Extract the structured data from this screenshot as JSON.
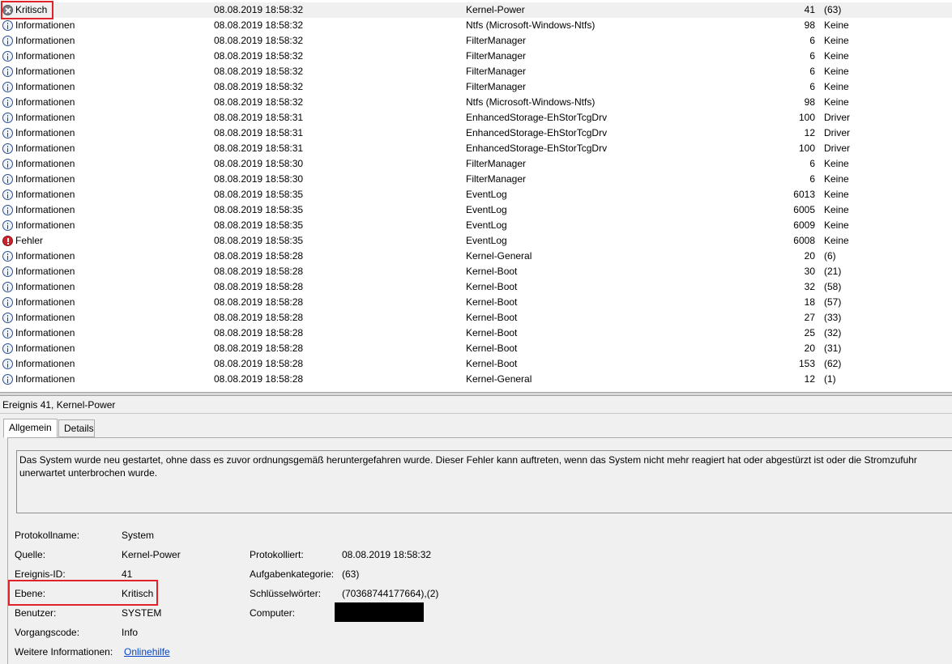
{
  "events": [
    {
      "level": "Kritisch",
      "icon": "critical-icon",
      "date": "08.08.2019 18:58:32",
      "source": "Kernel-Power",
      "id": "41",
      "task": "(63)"
    },
    {
      "level": "Informationen",
      "icon": "info-icon",
      "date": "08.08.2019 18:58:32",
      "source": "Ntfs (Microsoft-Windows-Ntfs)",
      "id": "98",
      "task": "Keine"
    },
    {
      "level": "Informationen",
      "icon": "info-icon",
      "date": "08.08.2019 18:58:32",
      "source": "FilterManager",
      "id": "6",
      "task": "Keine"
    },
    {
      "level": "Informationen",
      "icon": "info-icon",
      "date": "08.08.2019 18:58:32",
      "source": "FilterManager",
      "id": "6",
      "task": "Keine"
    },
    {
      "level": "Informationen",
      "icon": "info-icon",
      "date": "08.08.2019 18:58:32",
      "source": "FilterManager",
      "id": "6",
      "task": "Keine"
    },
    {
      "level": "Informationen",
      "icon": "info-icon",
      "date": "08.08.2019 18:58:32",
      "source": "FilterManager",
      "id": "6",
      "task": "Keine"
    },
    {
      "level": "Informationen",
      "icon": "info-icon",
      "date": "08.08.2019 18:58:32",
      "source": "Ntfs (Microsoft-Windows-Ntfs)",
      "id": "98",
      "task": "Keine"
    },
    {
      "level": "Informationen",
      "icon": "info-icon",
      "date": "08.08.2019 18:58:31",
      "source": "EnhancedStorage-EhStorTcgDrv",
      "id": "100",
      "task": "Driver"
    },
    {
      "level": "Informationen",
      "icon": "info-icon",
      "date": "08.08.2019 18:58:31",
      "source": "EnhancedStorage-EhStorTcgDrv",
      "id": "12",
      "task": "Driver"
    },
    {
      "level": "Informationen",
      "icon": "info-icon",
      "date": "08.08.2019 18:58:31",
      "source": "EnhancedStorage-EhStorTcgDrv",
      "id": "100",
      "task": "Driver"
    },
    {
      "level": "Informationen",
      "icon": "info-icon",
      "date": "08.08.2019 18:58:30",
      "source": "FilterManager",
      "id": "6",
      "task": "Keine"
    },
    {
      "level": "Informationen",
      "icon": "info-icon",
      "date": "08.08.2019 18:58:30",
      "source": "FilterManager",
      "id": "6",
      "task": "Keine"
    },
    {
      "level": "Informationen",
      "icon": "info-icon",
      "date": "08.08.2019 18:58:35",
      "source": "EventLog",
      "id": "6013",
      "task": "Keine"
    },
    {
      "level": "Informationen",
      "icon": "info-icon",
      "date": "08.08.2019 18:58:35",
      "source": "EventLog",
      "id": "6005",
      "task": "Keine"
    },
    {
      "level": "Informationen",
      "icon": "info-icon",
      "date": "08.08.2019 18:58:35",
      "source": "EventLog",
      "id": "6009",
      "task": "Keine"
    },
    {
      "level": "Fehler",
      "icon": "error-icon",
      "date": "08.08.2019 18:58:35",
      "source": "EventLog",
      "id": "6008",
      "task": "Keine"
    },
    {
      "level": "Informationen",
      "icon": "info-icon",
      "date": "08.08.2019 18:58:28",
      "source": "Kernel-General",
      "id": "20",
      "task": "(6)"
    },
    {
      "level": "Informationen",
      "icon": "info-icon",
      "date": "08.08.2019 18:58:28",
      "source": "Kernel-Boot",
      "id": "30",
      "task": "(21)"
    },
    {
      "level": "Informationen",
      "icon": "info-icon",
      "date": "08.08.2019 18:58:28",
      "source": "Kernel-Boot",
      "id": "32",
      "task": "(58)"
    },
    {
      "level": "Informationen",
      "icon": "info-icon",
      "date": "08.08.2019 18:58:28",
      "source": "Kernel-Boot",
      "id": "18",
      "task": "(57)"
    },
    {
      "level": "Informationen",
      "icon": "info-icon",
      "date": "08.08.2019 18:58:28",
      "source": "Kernel-Boot",
      "id": "27",
      "task": "(33)"
    },
    {
      "level": "Informationen",
      "icon": "info-icon",
      "date": "08.08.2019 18:58:28",
      "source": "Kernel-Boot",
      "id": "25",
      "task": "(32)"
    },
    {
      "level": "Informationen",
      "icon": "info-icon",
      "date": "08.08.2019 18:58:28",
      "source": "Kernel-Boot",
      "id": "20",
      "task": "(31)"
    },
    {
      "level": "Informationen",
      "icon": "info-icon",
      "date": "08.08.2019 18:58:28",
      "source": "Kernel-Boot",
      "id": "153",
      "task": "(62)"
    },
    {
      "level": "Informationen",
      "icon": "info-icon",
      "date": "08.08.2019 18:58:28",
      "source": "Kernel-General",
      "id": "12",
      "task": "(1)"
    }
  ],
  "detail": {
    "header": "Ereignis 41, Kernel-Power",
    "tabs": [
      "Allgemein",
      "Details"
    ],
    "description": "Das System wurde neu gestartet, ohne dass es zuvor ordnungsgemäß heruntergefahren wurde. Dieser Fehler kann auftreten, wenn das System nicht mehr reagiert hat oder abgestürzt ist oder die Stromzufuhr unerwartet unterbrochen wurde.",
    "labels": {
      "log_name": "Protokollname:",
      "source": "Quelle:",
      "event_id": "Ereignis-ID:",
      "level": "Ebene:",
      "user": "Benutzer:",
      "opcode": "Vorgangscode:",
      "more_info": "Weitere Informationen:",
      "logged": "Protokolliert:",
      "task_category": "Aufgabenkategorie:",
      "keywords": "Schlüsselwörter:",
      "computer": "Computer:"
    },
    "values": {
      "log_name": "System",
      "source": "Kernel-Power",
      "event_id": "41",
      "level": "Kritisch",
      "user": "SYSTEM",
      "opcode": "Info",
      "more_info": "Onlinehilfe",
      "logged": "08.08.2019 18:58:32",
      "task_category": "(63)",
      "keywords": "(70368744177664),(2)",
      "computer": ""
    }
  },
  "colors": {
    "highlight": "#e0232a",
    "selected_row": "#f0f0f0",
    "link": "#0645c8",
    "redaction": "#000000"
  }
}
